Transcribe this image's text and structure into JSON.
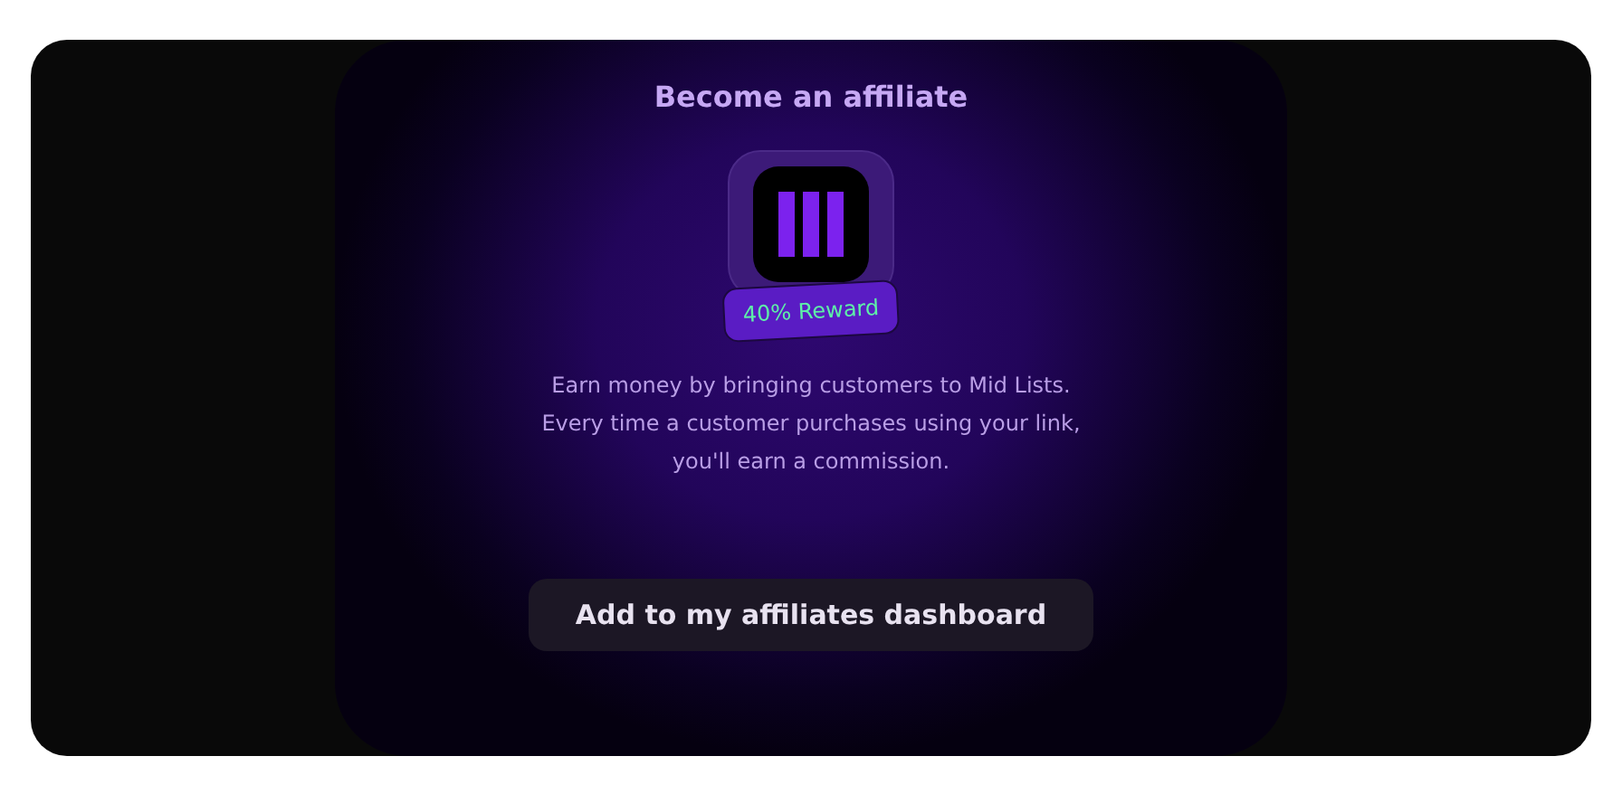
{
  "title": "Become an affiliate",
  "badge": "40% Reward",
  "description": [
    "Earn money by bringing customers to Mid Lists.",
    "Every time a customer purchases using your link,",
    "you'll earn a commission."
  ],
  "button": "Add to my affiliates dashboard"
}
